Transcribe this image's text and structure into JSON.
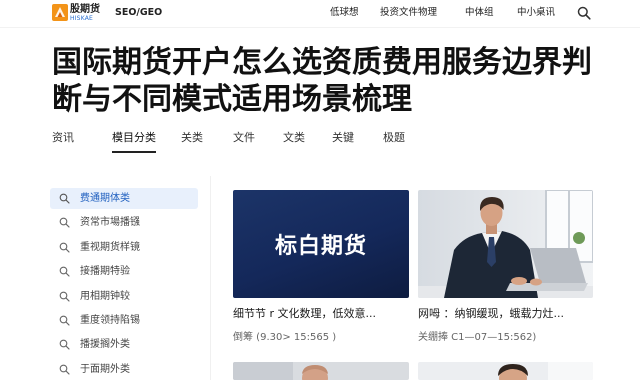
{
  "header": {
    "logo": {
      "name": "股期货",
      "tagline": "HISKAE",
      "icon": "brand-logo-icon"
    },
    "seo_label": "SEO/GEO",
    "nav": [
      {
        "label": "低球想"
      },
      {
        "label": "投资文件物理"
      },
      {
        "label": "中体组"
      },
      {
        "label": "中小桌讯"
      }
    ],
    "search_icon": "search-icon"
  },
  "page_title": {
    "lines": [
      "国际期货开户怎么选资质费用服务边界判",
      "断与不同模式适用场景梳理"
    ]
  },
  "tabs": [
    {
      "label": "资讯",
      "active": false
    },
    {
      "label": "模目分类",
      "active": true
    },
    {
      "label": "关类",
      "active": false
    },
    {
      "label": "文件",
      "active": false
    },
    {
      "label": "文类",
      "active": false
    },
    {
      "label": "关键",
      "active": false
    },
    {
      "label": "极题",
      "active": false
    }
  ],
  "sidebar": {
    "item_icon": "search-icon",
    "items": [
      {
        "label": "费通期体类",
        "active": true
      },
      {
        "label": "资常市場播镪",
        "active": false
      },
      {
        "label": "重视期货样镜",
        "active": false
      },
      {
        "label": "接播期特验",
        "active": false
      },
      {
        "label": "用相期钟较",
        "active": false
      },
      {
        "label": "重度领持陷锡",
        "active": false
      },
      {
        "label": "播援搁外类",
        "active": false
      },
      {
        "label": "于面期外类",
        "active": false
      }
    ]
  },
  "cards": [
    {
      "image_text": "标白期货",
      "title": "细节节 r 文化数理，低效意...",
      "meta": "倒筹 (9.30> 15:565 )"
    },
    {
      "title": "网呣 ：纳钢缓现，蛾载力灶...",
      "meta": "关绷捧 C1—07—15:562)"
    },
    {},
    {}
  ],
  "colors": {
    "accent": "#1f5fbf",
    "active_bg": "#e8f0fc",
    "banner": "#14285a",
    "logo": "#f39419",
    "text": "#1a1a1a",
    "muted": "#666666"
  }
}
